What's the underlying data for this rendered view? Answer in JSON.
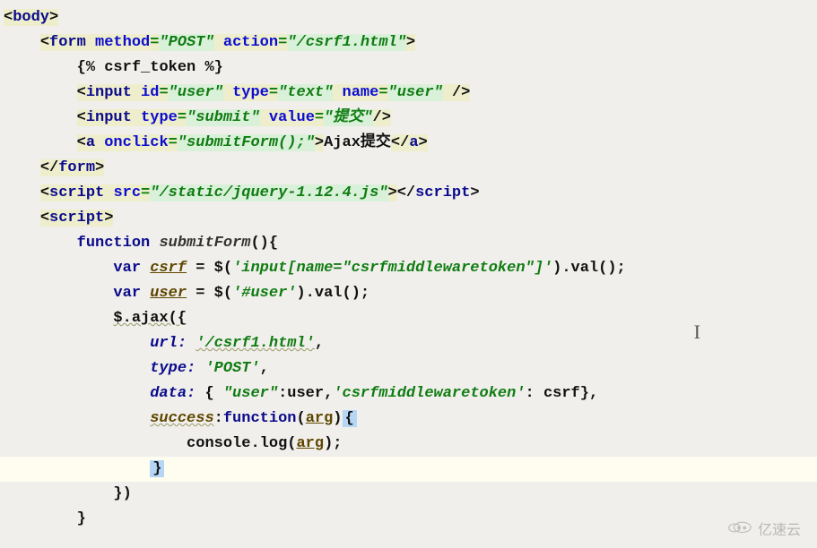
{
  "watermark": {
    "text": "亿速云"
  },
  "cursor": "I",
  "code": {
    "l1": {
      "tag": "body"
    },
    "l2": {
      "tag": "form",
      "a1n": "method",
      "a1v": "\"POST\"",
      "a2n": "action",
      "a2v": "\"/csrf1.html\""
    },
    "l3": {
      "text": "{% csrf_token %}"
    },
    "l4": {
      "tag": "input",
      "a1n": "id",
      "a1v": "\"user\"",
      "a2n": "type",
      "a2v": "\"text\"",
      "a3n": "name",
      "a3v": "\"user\"",
      "close": " />"
    },
    "l5": {
      "tag": "input",
      "a1n": "type",
      "a1v": "\"submit\"",
      "a2n": "value",
      "a2v": "\"提交\"",
      "close": "/>"
    },
    "l6": {
      "tag": "a",
      "a1n": "onclick",
      "a1v": "\"submitForm();\"",
      "inner": "Ajax提交",
      "close": "a"
    },
    "l7": {
      "close": "form"
    },
    "l8": {
      "tag": "script",
      "a1n": "src",
      "a1v": "\"/static/jquery-1.12.4.js\"",
      "closeTag": "script"
    },
    "l9": {
      "tag": "script"
    },
    "l10": {
      "kw": "function",
      "name": "submitForm",
      "paren": "(){",
      "prefix": "        "
    },
    "l11": {
      "kw": "var",
      "name": "csrf",
      "rest1": " = $(",
      "str": "'input[name=\"csrfmiddlewaretoken\"]'",
      "rest2": ").val();"
    },
    "l12": {
      "kw": "var",
      "name": "user",
      "rest1": " = $(",
      "str": "'#user'",
      "rest2": ").val();"
    },
    "l13": {
      "text": "$.ajax({"
    },
    "l14": {
      "prop": "url:",
      "val": "'/csrf1.html'",
      "tail": ","
    },
    "l15": {
      "prop": "type:",
      "val": "'POST'",
      "tail": ","
    },
    "l16": {
      "prop": "data:",
      "open": " { ",
      "k1": "\"user\"",
      "c1": ":user,",
      "k2": "'csrfmiddlewaretoken'",
      "c2": ": csrf},"
    },
    "l17": {
      "prop": "success",
      "colon": ":",
      "kw": "function",
      "paren": "(",
      "arg": "arg",
      "paren2": ")",
      "brace": "{"
    },
    "l18": {
      "call": "console.log",
      "open": "(",
      "arg": "arg",
      "close": ");"
    },
    "l19": {
      "brace": "}"
    },
    "l20": {
      "close": "})"
    },
    "l21": {
      "brace": "}"
    }
  }
}
